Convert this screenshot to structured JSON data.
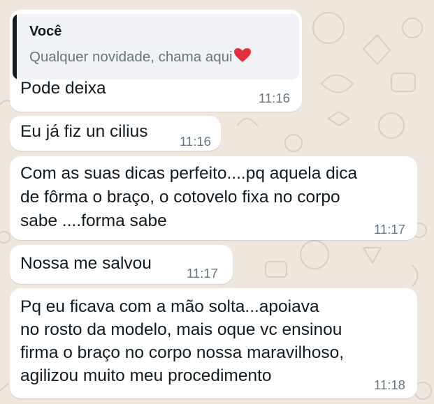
{
  "chat": {
    "messages": [
      {
        "quote": {
          "author": "Você",
          "text": "Qualquer novidade, chama aqui",
          "icon": "heart-icon"
        },
        "text": "Pode deixa",
        "time": "11:16"
      },
      {
        "text": "Eu já fiz un cilius",
        "time": "11:16"
      },
      {
        "lines": [
          "Com as suas dicas perfeito....pq aquela dica",
          "de fôrma o braço, o cotovelo fixa no corpo",
          "sabe ....forma sabe"
        ],
        "time": "11:17"
      },
      {
        "text": "Nossa me salvou",
        "time": "11:17"
      },
      {
        "lines": [
          "Pq eu ficava com a mão solta...apoiava",
          "no rosto da modelo, mais oque vc ensinou",
          "firma o braço no corpo nossa maravilhoso,",
          "agilizou muito meu procedimento"
        ],
        "time": "11:18"
      }
    ]
  },
  "colors": {
    "background": "#efe7dd",
    "bubble": "#ffffff",
    "quote_background": "#f0f2f5",
    "quote_bar": "#111b21",
    "heart": "#e0303d",
    "timestamp": "#667781"
  }
}
